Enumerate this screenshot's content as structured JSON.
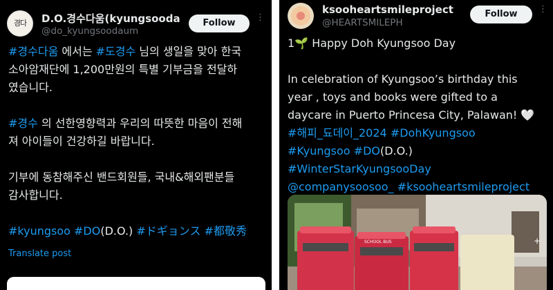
{
  "left_post": {
    "display_name": "D.O.경수다움(kyungsoodau...",
    "handle": "@do_kyungsoodaum",
    "follow_label": "Follow",
    "more_label": "···",
    "body_lines": [
      [
        {
          "t": "#경수다움",
          "tag": true
        },
        {
          "t": " 에서는 ",
          "tag": false
        },
        {
          "t": "#도경수",
          "tag": true
        },
        {
          "t": " 님의 생일을 맞아 한국",
          "tag": false
        }
      ],
      [
        {
          "t": "소아암재단에 1,200만원의 특별 기부금을 전달하",
          "tag": false
        }
      ],
      [
        {
          "t": "였습니다.",
          "tag": false
        }
      ],
      [],
      [
        {
          "t": "#경수",
          "tag": true
        },
        {
          "t": " 의 선한영향력과 우리의 따뜻한 마음이 전해",
          "tag": false
        }
      ],
      [
        {
          "t": "져 아이들이 건강하길 바랍니다.",
          "tag": false
        }
      ],
      [],
      [
        {
          "t": "기부에 동참해주신 밴드회원들, 국내&해외팬분들",
          "tag": false
        }
      ],
      [
        {
          "t": "감사합니다.",
          "tag": false
        }
      ],
      [],
      [
        {
          "t": "#kyungsoo",
          "tag": true
        },
        {
          "t": " ",
          "tag": false
        },
        {
          "t": "#DO",
          "tag": true
        },
        {
          "t": "(D.O.) ",
          "tag": false
        },
        {
          "t": "#ドギョンス",
          "tag": true
        },
        {
          "t": " ",
          "tag": false
        },
        {
          "t": "#都敬秀",
          "tag": true
        }
      ]
    ],
    "translate_label": "Translate post"
  },
  "right_post": {
    "display_name": "ksooheartsmileproject",
    "handle": "@HEARTSMILEPH",
    "follow_label": "Follow",
    "more_label": "···",
    "body_lines": [
      [
        {
          "t": "1🌱 Happy Doh Kyungsoo Day",
          "tag": false
        }
      ],
      [],
      [
        {
          "t": "In celebration of Kyungsoo’s birthday this",
          "tag": false
        }
      ],
      [
        {
          "t": "year , toys and books were gifted to a",
          "tag": false
        }
      ],
      [
        {
          "t": "daycare in Puerto Princesa City, Palawan! 🤍",
          "tag": false
        }
      ],
      [
        {
          "t": "#해피_됴데이_2024",
          "tag": true
        },
        {
          "t": " ",
          "tag": false
        },
        {
          "t": "#DohKyungsoo",
          "tag": true
        }
      ],
      [
        {
          "t": "#Kyungsoo",
          "tag": true
        },
        {
          "t": " ",
          "tag": false
        },
        {
          "t": "#DO",
          "tag": true
        },
        {
          "t": "(D.O.)",
          "tag": false
        }
      ],
      [
        {
          "t": "#WinterStarKyungsooDay",
          "tag": true
        }
      ],
      [
        {
          "t": "@companysoosoo_",
          "tag": true
        },
        {
          "t": " ",
          "tag": false
        },
        {
          "t": "#ksooheartsmileproject",
          "tag": true
        }
      ]
    ],
    "media_label": "SCHOOL BUS"
  },
  "colors": {
    "background": "#000000",
    "text": "#e7e9ea",
    "secondary": "#71767b",
    "link": "#1d9bf0",
    "follow_bg": "#eff3f4"
  },
  "icons": {
    "more": "more-horizontal-icon",
    "media_expand": "plus-icon"
  }
}
